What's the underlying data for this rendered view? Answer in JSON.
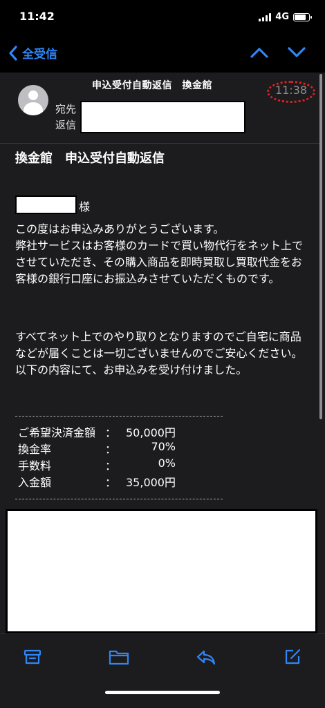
{
  "status_bar": {
    "time": "11:42",
    "network": "4G"
  },
  "nav": {
    "back_label": "全受信"
  },
  "header": {
    "subject": "申込受付自動返信　換金館",
    "to_label": "宛先",
    "reply_label": "返信",
    "time": "11:38"
  },
  "body": {
    "title": "換金館　申込受付自動返信",
    "honorific": "様",
    "para1": [
      "この度はお申込みありがとうございます。",
      "弊社サービスはお客様のカードで買い物代行をネット上でさせていただき、その購入商品を即時買取し買取代金をお客様の銀行口座にお振込みさせていただくものです。"
    ],
    "para2": [
      "すべてネット上でのやり取りとなりますのでご自宅に商品などが届くことは一切ございませんのでご安心ください。",
      "以下の内容にて、お申込みを受け付けました。"
    ],
    "details": [
      {
        "label": "ご希望決済金額",
        "colon": "：",
        "value": "50,000円"
      },
      {
        "label": "換金率",
        "colon": "：",
        "value": "70%"
      },
      {
        "label": "手数料",
        "colon": "：",
        "value": "0%"
      },
      {
        "label": "入金額",
        "colon": "：",
        "value": "35,000円"
      }
    ]
  },
  "icons": {
    "back": "chevron-left-icon",
    "prev": "chevron-up-icon",
    "next": "chevron-down-icon",
    "archive": "archive-box-icon",
    "folder": "folder-icon",
    "reply": "reply-icon",
    "compose": "compose-icon"
  },
  "colors": {
    "accent": "#2f86f6",
    "background": "#1c1c1e",
    "annotation": "#e02020"
  }
}
